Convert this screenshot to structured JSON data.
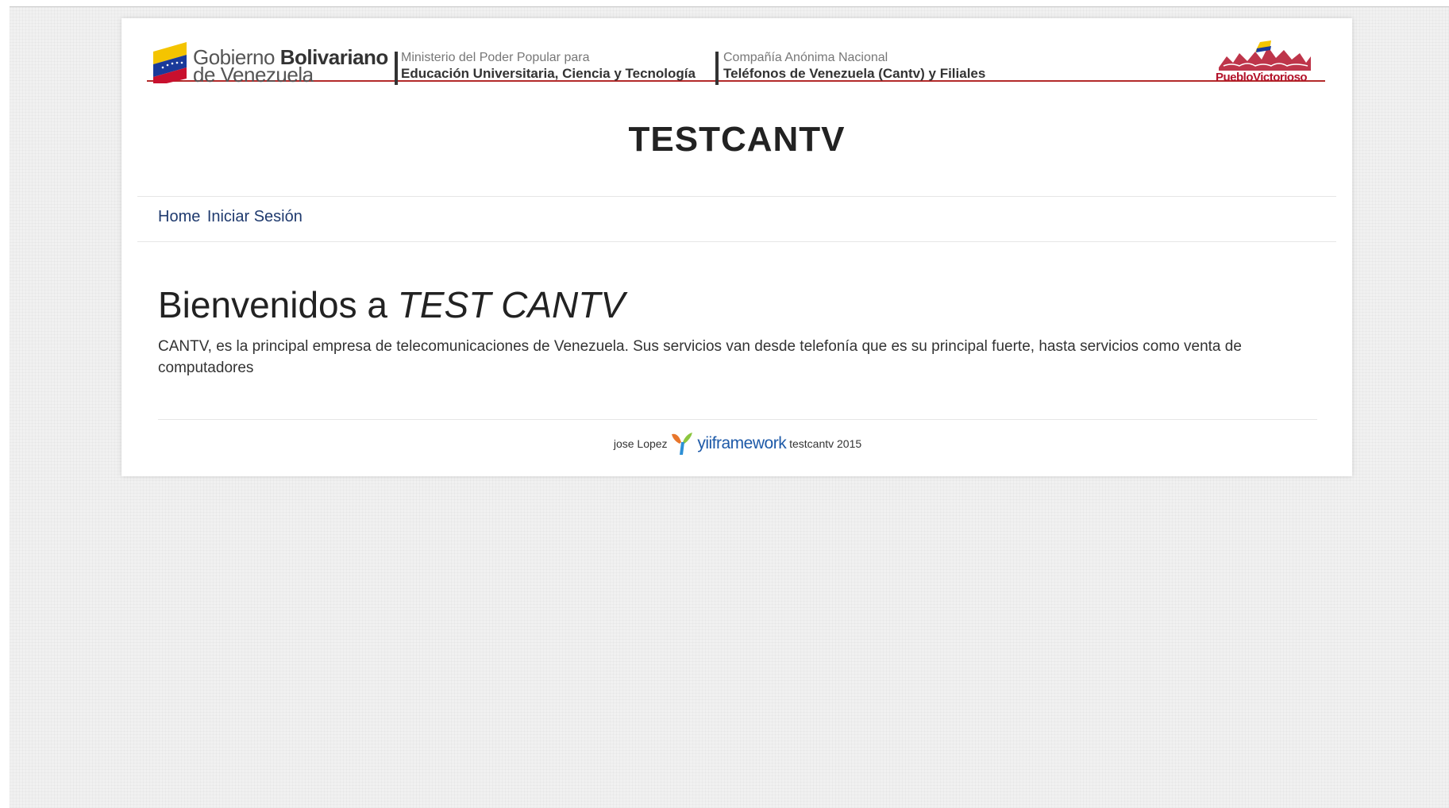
{
  "banner": {
    "gob_line1_light": "Gobierno",
    "gob_line1_bold": "Bolivariano",
    "gob_line2": "de Venezuela",
    "ministry_small": "Ministerio del Poder Popular para",
    "ministry_bold": "Educación Universitaria, Ciencia y Tecnología",
    "company_small": "Compañía  Anónima Nacional",
    "company_bold": "Teléfonos de Venezuela (Cantv) y Filiales",
    "pv_logo_text": "PuebloVictorioso"
  },
  "site_title": "TESTCANTV",
  "nav": {
    "home": "Home",
    "login": "Iniciar Sesión"
  },
  "content": {
    "welcome_plain": "Bienvenidos a",
    "welcome_italic": "TEST CANTV",
    "intro": "CANTV, es la principal empresa de telecomunicaciones de Venezuela. Sus servicios van desde telefonía que es su principal fuerte, hasta servicios como venta de computadores"
  },
  "footer": {
    "author": "jose Lopez",
    "framework": "yiiframework",
    "suffix": "testcantv 2015"
  },
  "colors": {
    "banner_rule": "#b32a2a",
    "nav_link": "#1f3a6e",
    "yii_blue": "#1e5aa8"
  }
}
